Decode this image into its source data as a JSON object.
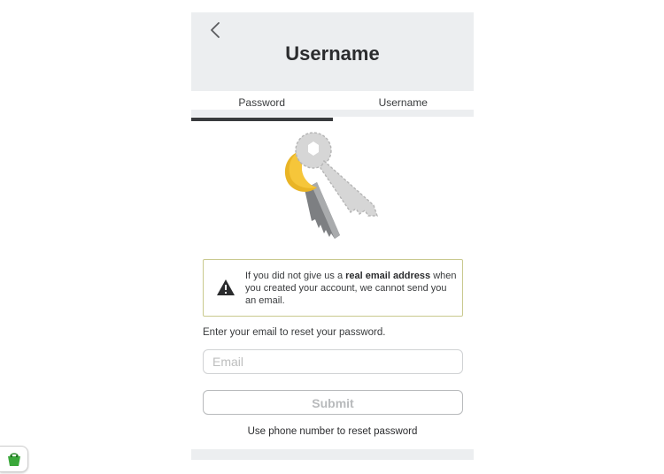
{
  "header": {
    "back_icon": "chevron-left-icon",
    "title": "Username"
  },
  "tabs": [
    {
      "label": "Password",
      "active": true
    },
    {
      "label": "Username",
      "active": false
    }
  ],
  "illustration": {
    "icon": "keys-icon"
  },
  "warning": {
    "icon": "warning-triangle-icon",
    "text_before": "If you did not give us a ",
    "text_bold": "real email address",
    "text_after": " when you created your account, we cannot send you an email.",
    "border_color": "#c9c98e"
  },
  "form": {
    "instruction": "Enter your email to reset your password.",
    "email_placeholder": "Email",
    "email_value": "",
    "submit_label": "Submit",
    "phone_link": "Use phone number to reset password"
  },
  "extension_badge": {
    "icon": "shopping-bag-icon"
  },
  "colors": {
    "header_bg": "#eceef0",
    "text": "#393b3d",
    "tab_indicator": "#393b3d",
    "key_gold": "#e9b425",
    "key_silver": "#d6d6d6",
    "disabled": "#b8babc"
  }
}
